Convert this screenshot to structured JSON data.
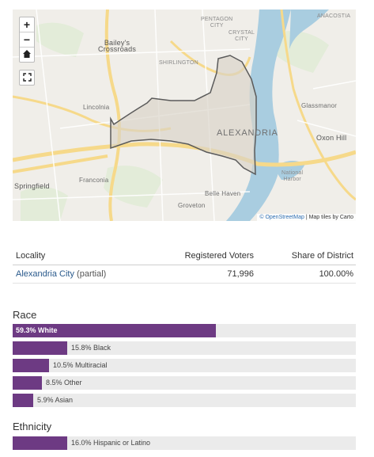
{
  "map": {
    "controls": {
      "zoom_in": "+",
      "zoom_out": "−",
      "home": "⌂",
      "fullscreen": "⛶"
    },
    "labels": {
      "pentagon_city": "PENTAGON\nCITY",
      "anacostia": "ANACOSTIA",
      "crystal_city": "CRYSTAL\nCITY",
      "baileys_crossroads": "Bailey's\nCrossroads",
      "shirlington": "SHIRLINGTON",
      "lincolnia": "Lincolnia",
      "glassmanor": "Glassmanor",
      "alexandria": "ALEXANDRIA",
      "oxon_hill": "Oxon Hill",
      "national_harbor": "National\nHarbor",
      "franconia": "Franconia",
      "springfield": "Springfield",
      "belle_haven": "Belle Haven",
      "groveton": "Groveton"
    },
    "attribution_link": "© OpenStreetMap",
    "attribution_rest": " | Map tiles by Carto"
  },
  "table": {
    "headers": [
      "Locality",
      "Registered Voters",
      "Share of District"
    ],
    "rows": [
      {
        "locality": "Alexandria City",
        "qualifier": " (partial)",
        "voters": "71,996",
        "share": "100.00%"
      }
    ]
  },
  "race": {
    "title": "Race",
    "bars": [
      {
        "label": "59.3% White",
        "value": 59.3
      },
      {
        "label": "15.8% Black",
        "value": 15.8
      },
      {
        "label": "10.5% Multiracial",
        "value": 10.5
      },
      {
        "label": "8.5% Other",
        "value": 8.5
      },
      {
        "label": "5.9% Asian",
        "value": 5.9
      }
    ]
  },
  "ethnicity": {
    "title": "Ethnicity",
    "bars": [
      {
        "label": "16.0% Hispanic or Latino",
        "value": 16.0
      }
    ]
  },
  "colors": {
    "bar_fill": "#6d3a83",
    "bar_track": "#ebebeb",
    "water": "#a9cde0",
    "district_fill": "#d9d3c7",
    "district_stroke": "#5a5a5a"
  }
}
